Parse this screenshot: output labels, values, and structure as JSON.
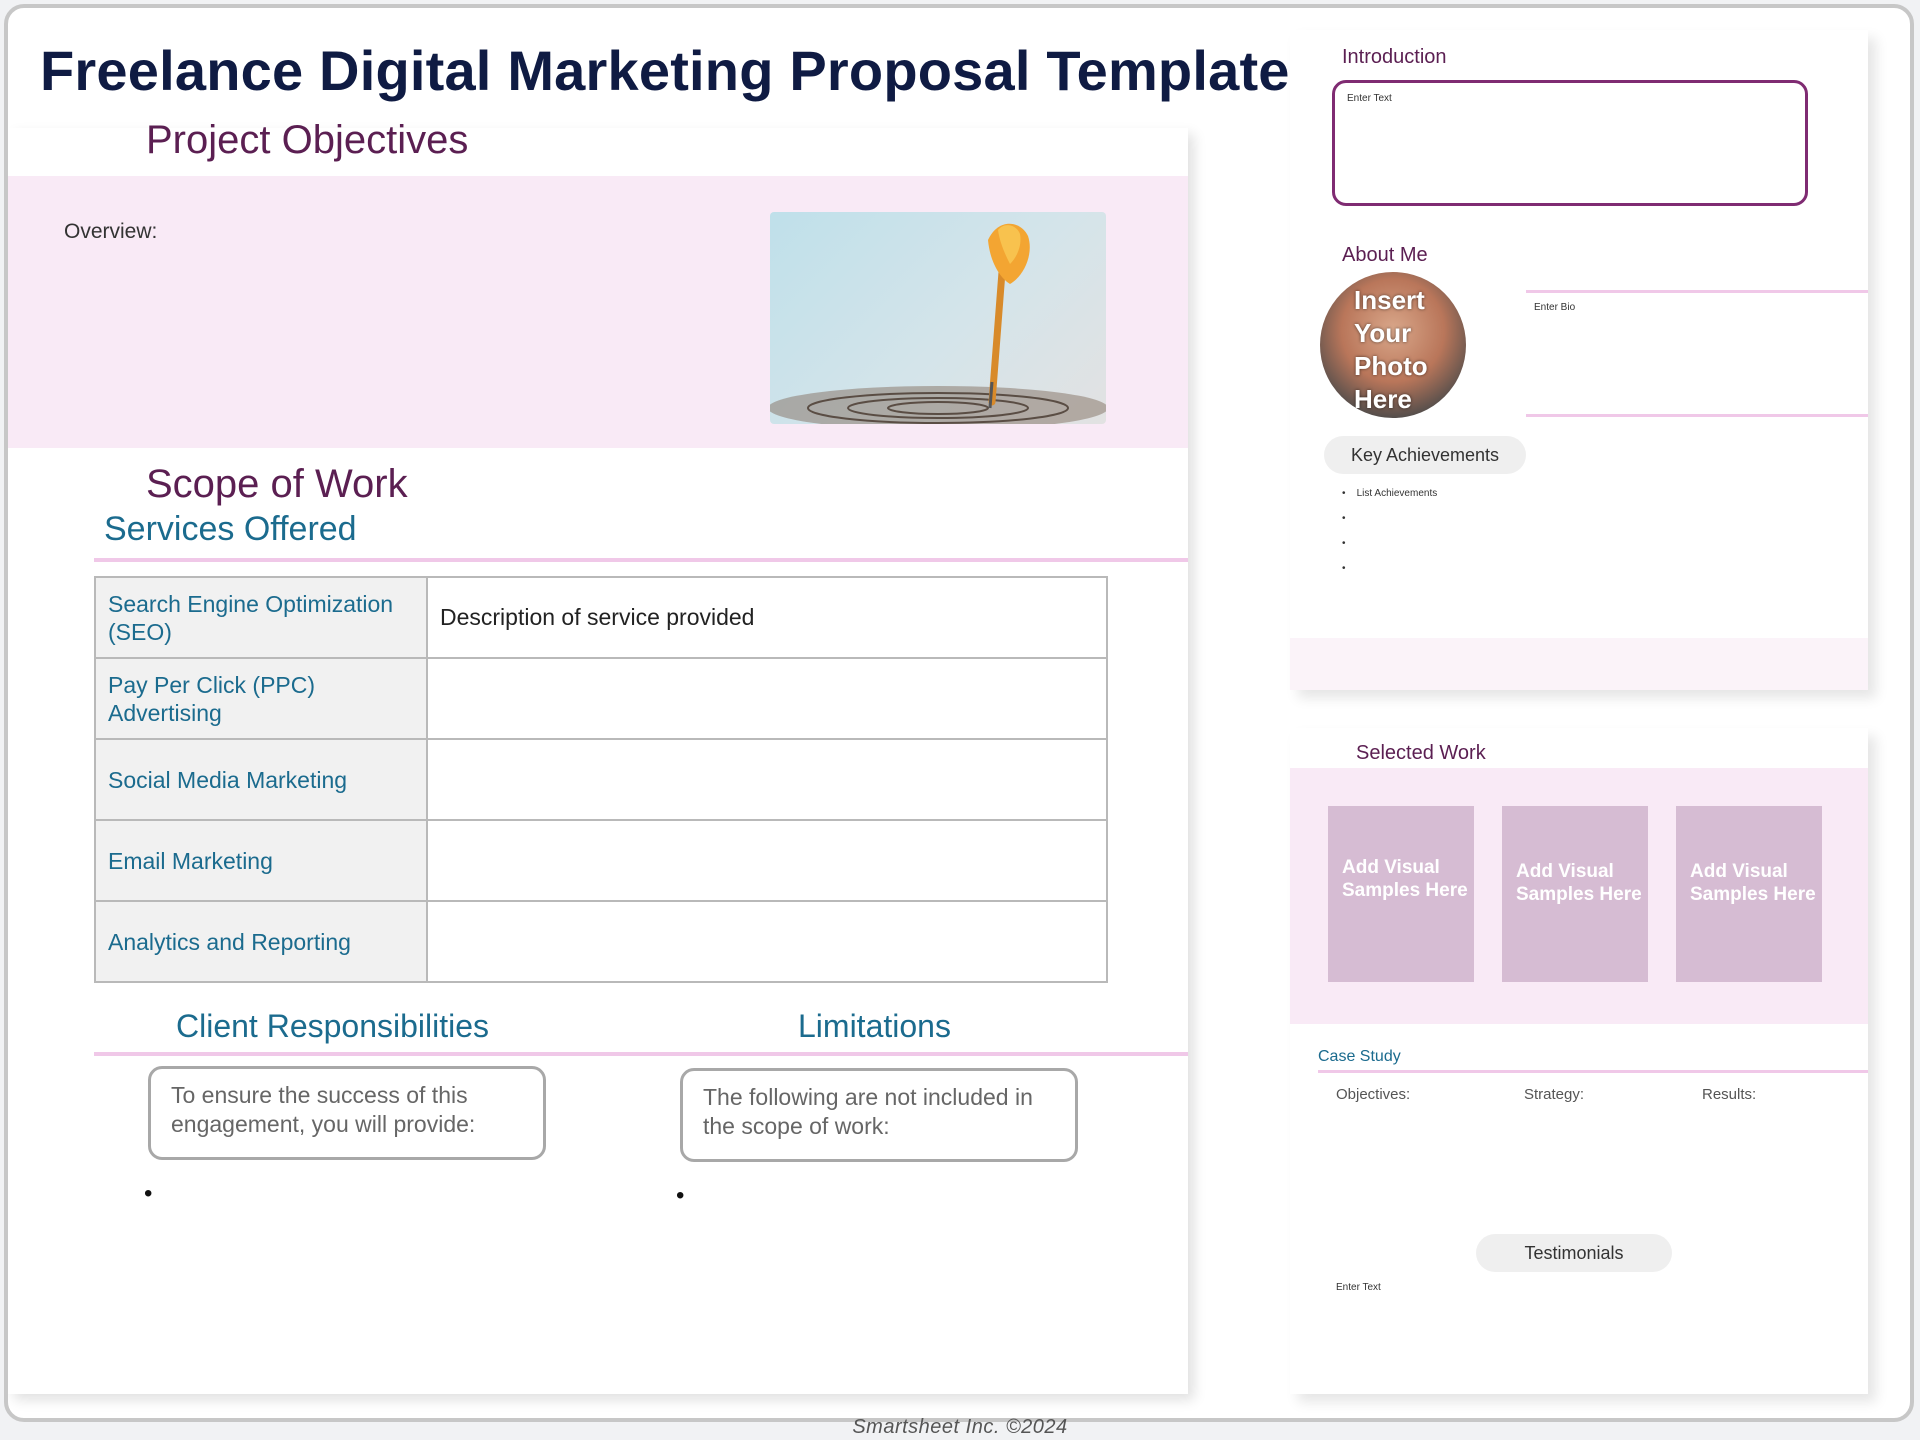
{
  "title": "Freelance Digital Marketing Proposal Template",
  "left_page": {
    "project_objectives": "Project Objectives",
    "overview_label": "Overview:",
    "scope_of_work": "Scope of Work",
    "services_offered": "Services Offered",
    "services": [
      {
        "name": "Search Engine Optimization (SEO)",
        "description": "Description of service provided"
      },
      {
        "name": "Pay Per Click (PPC) Advertising",
        "description": ""
      },
      {
        "name": "Social Media Marketing",
        "description": ""
      },
      {
        "name": "Email Marketing",
        "description": ""
      },
      {
        "name": "Analytics and Reporting",
        "description": ""
      }
    ],
    "client_responsibilities": {
      "heading": "Client Responsibilities",
      "text": "To ensure the success of this engagement, you will provide:",
      "bullet": "•"
    },
    "limitations": {
      "heading": "Limitations",
      "text": "The following are not included in the scope of work:",
      "bullet": "•"
    }
  },
  "right_page_1": {
    "introduction_label": "Introduction",
    "introduction_placeholder": "Enter Text",
    "about_me_label": "About Me",
    "photo_placeholder": "Insert Your Photo Here",
    "bio_placeholder": "Enter Bio",
    "key_achievements_label": "Key Achievements",
    "achievements": [
      "List Achievements",
      "",
      "",
      ""
    ]
  },
  "right_page_2": {
    "selected_work_label": "Selected Work",
    "samples": [
      "Add Visual Samples Here",
      "Add Visual Samples Here",
      "Add Visual Samples Here"
    ],
    "case_study_label": "Case Study",
    "case_study_columns": [
      "Objectives:",
      "Strategy:",
      "Results:"
    ],
    "testimonials_label": "Testimonials",
    "testimonials_placeholder": "Enter Text"
  },
  "footer": "Smartsheet Inc. ©2024",
  "colors": {
    "title": "#0f1b43",
    "section_purple": "#5b1f52",
    "teal": "#1b6b8e",
    "pink_band": "#f9eaf6",
    "sample_tile": "#d6bcd3"
  }
}
